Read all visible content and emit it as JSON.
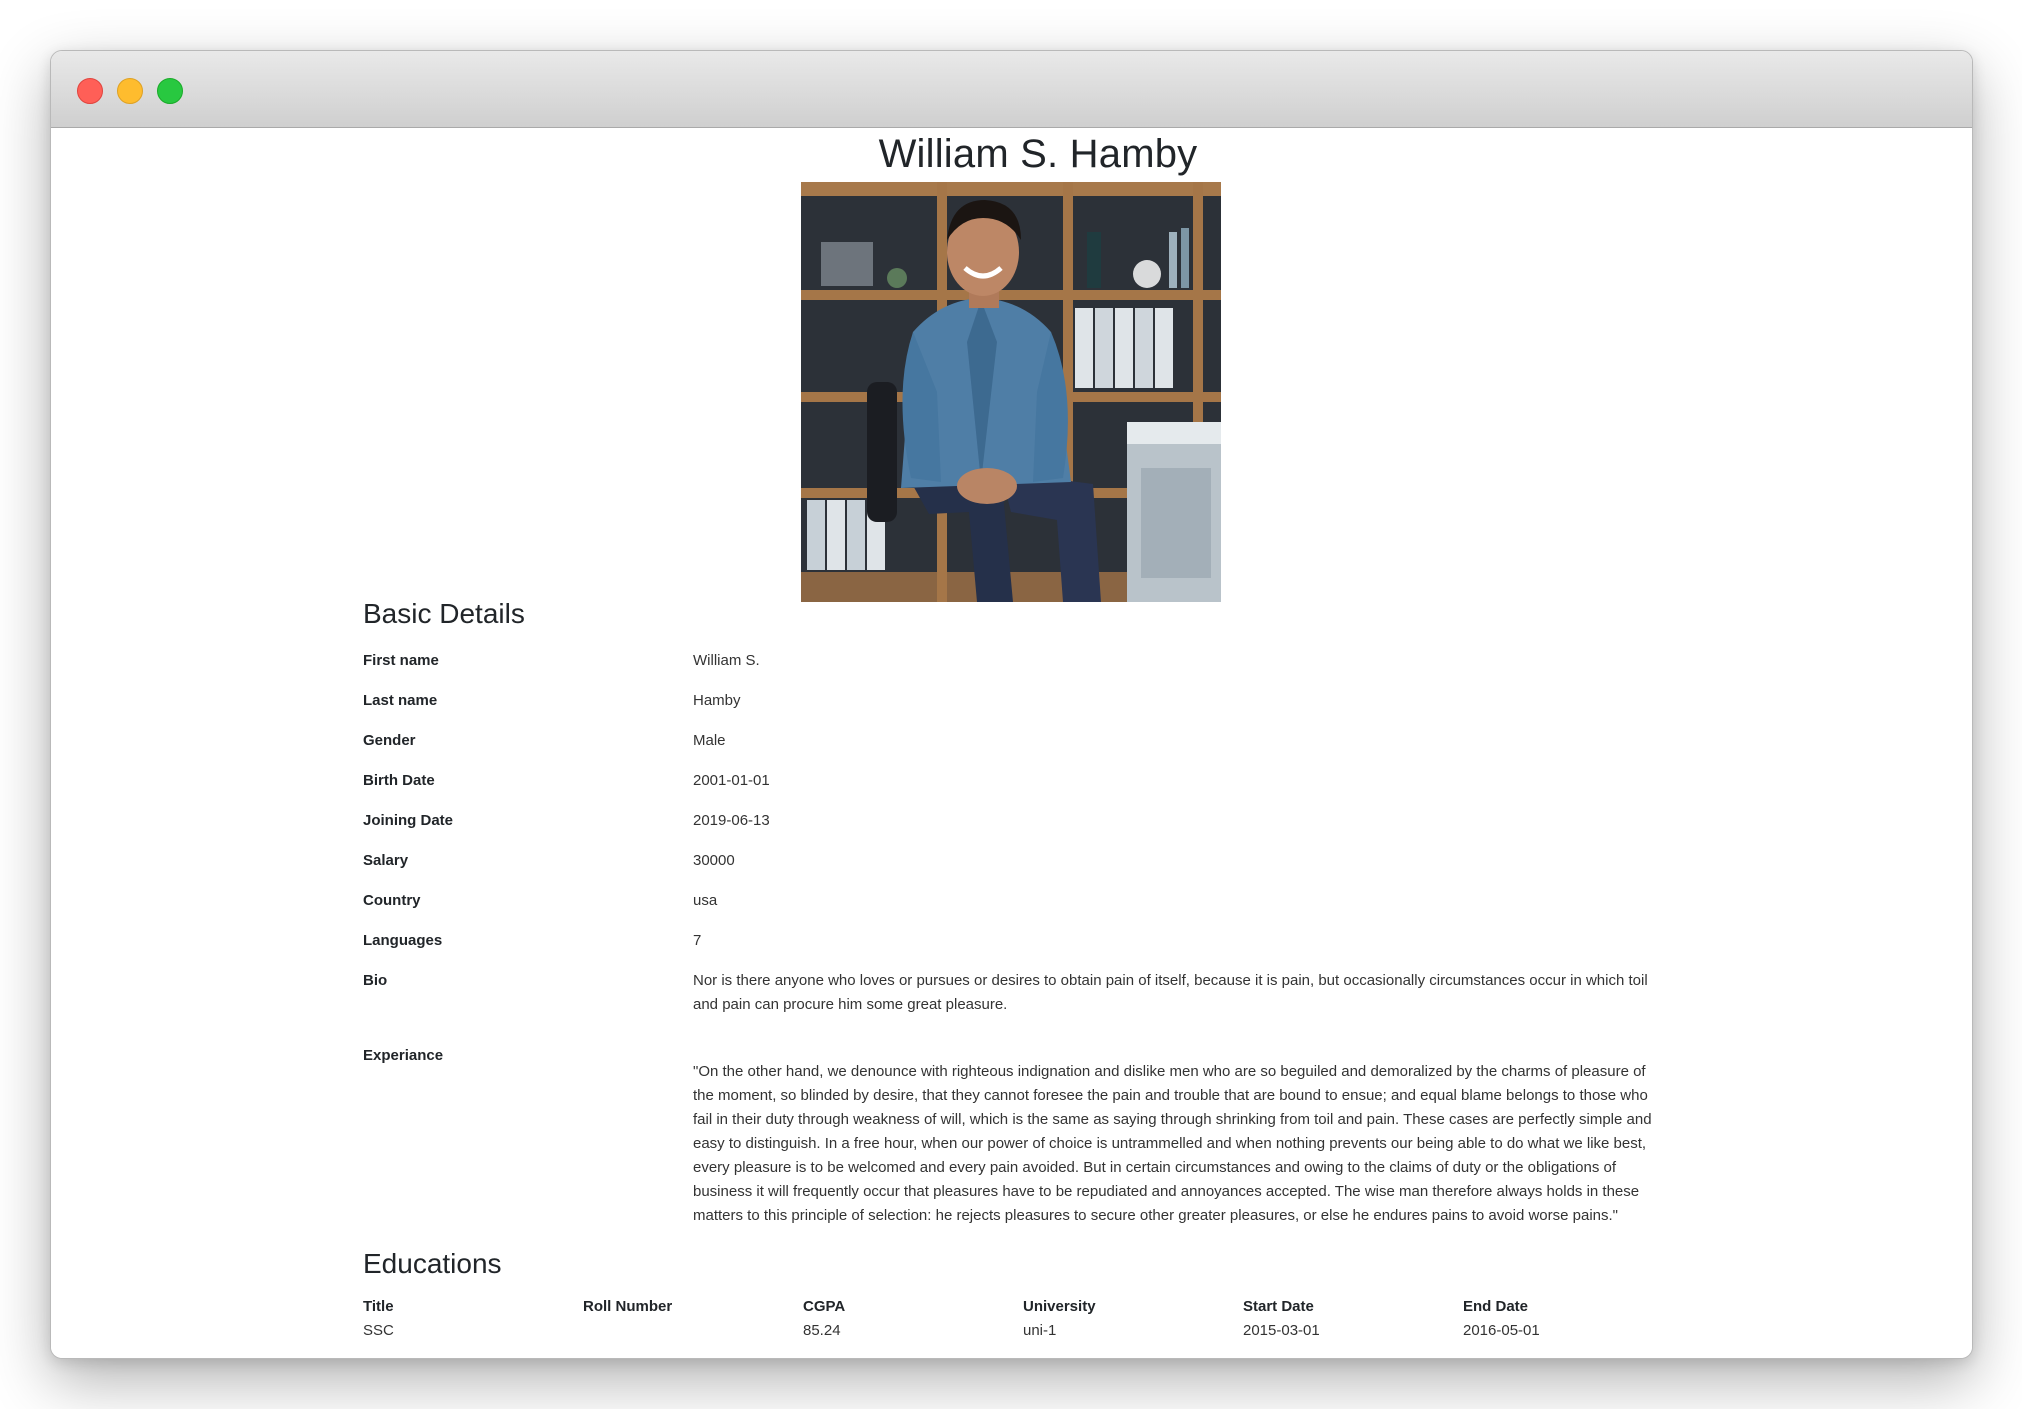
{
  "window": {
    "controls": [
      "close",
      "minimize",
      "maximize"
    ]
  },
  "profile": {
    "name": "William S. Hamby",
    "photo_icon": "person-photo"
  },
  "basic": {
    "title": "Basic Details",
    "rows": [
      {
        "label": "First name",
        "value": "William S."
      },
      {
        "label": "Last name",
        "value": "Hamby"
      },
      {
        "label": "Gender",
        "value": "Male"
      },
      {
        "label": "Birth Date",
        "value": "2001-01-01"
      },
      {
        "label": "Joining Date",
        "value": "2019-06-13"
      },
      {
        "label": "Salary",
        "value": "30000"
      },
      {
        "label": "Country",
        "value": "usa"
      },
      {
        "label": "Languages",
        "value": "7"
      },
      {
        "label": "Bio",
        "value": "Nor is there anyone who loves or pursues or desires to obtain pain of itself, because it is pain, but occasionally circumstances occur in which toil and pain can procure him some great pleasure."
      },
      {
        "label": "Experiance",
        "value": "\"On the other hand, we denounce with righteous indignation and dislike men who are so beguiled and demoralized by the charms of pleasure of the moment, so blinded by desire, that they cannot foresee the pain and trouble that are bound to ensue; and equal blame belongs to those who fail in their duty through weakness of will, which is the same as saying through shrinking from toil and pain. These cases are perfectly simple and easy to distinguish. In a free hour, when our power of choice is untrammelled and when nothing prevents our being able to do what we like best, every pleasure is to be welcomed and every pain avoided. But in certain circumstances and owing to the claims of duty or the obligations of business it will frequently occur that pleasures have to be repudiated and annoyances accepted. The wise man therefore always holds in these matters to this principle of selection: he rejects pleasures to secure other greater pleasures, or else he endures pains to avoid worse pains.\""
      }
    ]
  },
  "educations": {
    "title": "Educations",
    "columns": [
      "Title",
      "Roll Number",
      "CGPA",
      "University",
      "Start Date",
      "End Date"
    ],
    "rows": [
      [
        "SSC",
        "",
        "85.24",
        "uni-1",
        "2015-03-01",
        "2016-05-01"
      ]
    ]
  }
}
